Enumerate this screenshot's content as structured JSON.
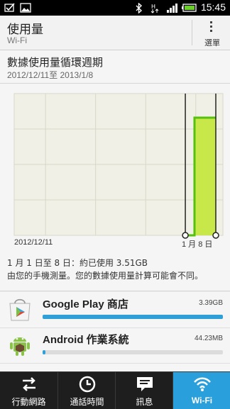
{
  "status_bar": {
    "time": "15:45",
    "icons": [
      "checked-box-icon",
      "image-icon",
      "bluetooth-icon",
      "hsdpa-icon",
      "signal-icon",
      "battery-icon"
    ]
  },
  "header": {
    "title": "使用量",
    "subtitle": "Wi-Fi",
    "menu_label": "選單"
  },
  "cycle": {
    "title": "數據使用量循環週期",
    "dates": "2012/12/11至 2013/1/8"
  },
  "chart_data": {
    "type": "bar",
    "x_start_label": "2012/12/11",
    "x_end_label": "1 月 8 日",
    "categories": [
      "2012/12/11 – 2013/1/7",
      "2013/1/8"
    ],
    "values": [
      0,
      3.51
    ],
    "unit": "GB",
    "range_start_fraction": 0.82,
    "range_end_fraction": 1.0,
    "colors": {
      "fill": "#c8e84a",
      "line": "#55c10a",
      "grid": "#d8d8c8",
      "plot_bg": "#f0f0e6"
    }
  },
  "usage": {
    "summary": "1 月 1 日至 8 日：約已使用 3.51GB",
    "note": "由您的手機測量。您的數據使用量計算可能會不同。"
  },
  "apps": [
    {
      "name": "Google Play 商店",
      "size": "3.39GB",
      "fraction": 1.0,
      "icon": "google-play-store-icon"
    },
    {
      "name": "Android 作業系統",
      "size": "44.23MB",
      "fraction": 0.013,
      "icon": "android-robot-icon"
    }
  ],
  "tabs": [
    {
      "label": "行動網路",
      "icon": "mobile-network-arrows-icon",
      "active": false
    },
    {
      "label": "通話時間",
      "icon": "clock-icon",
      "active": false
    },
    {
      "label": "訊息",
      "icon": "message-icon",
      "active": false
    },
    {
      "label": "Wi-Fi",
      "icon": "wifi-icon",
      "active": true
    }
  ],
  "colors": {
    "accent": "#29a0db",
    "bar": "#2f9fd8",
    "chart_fill": "#c8e84a",
    "chart_line": "#55c10a"
  }
}
